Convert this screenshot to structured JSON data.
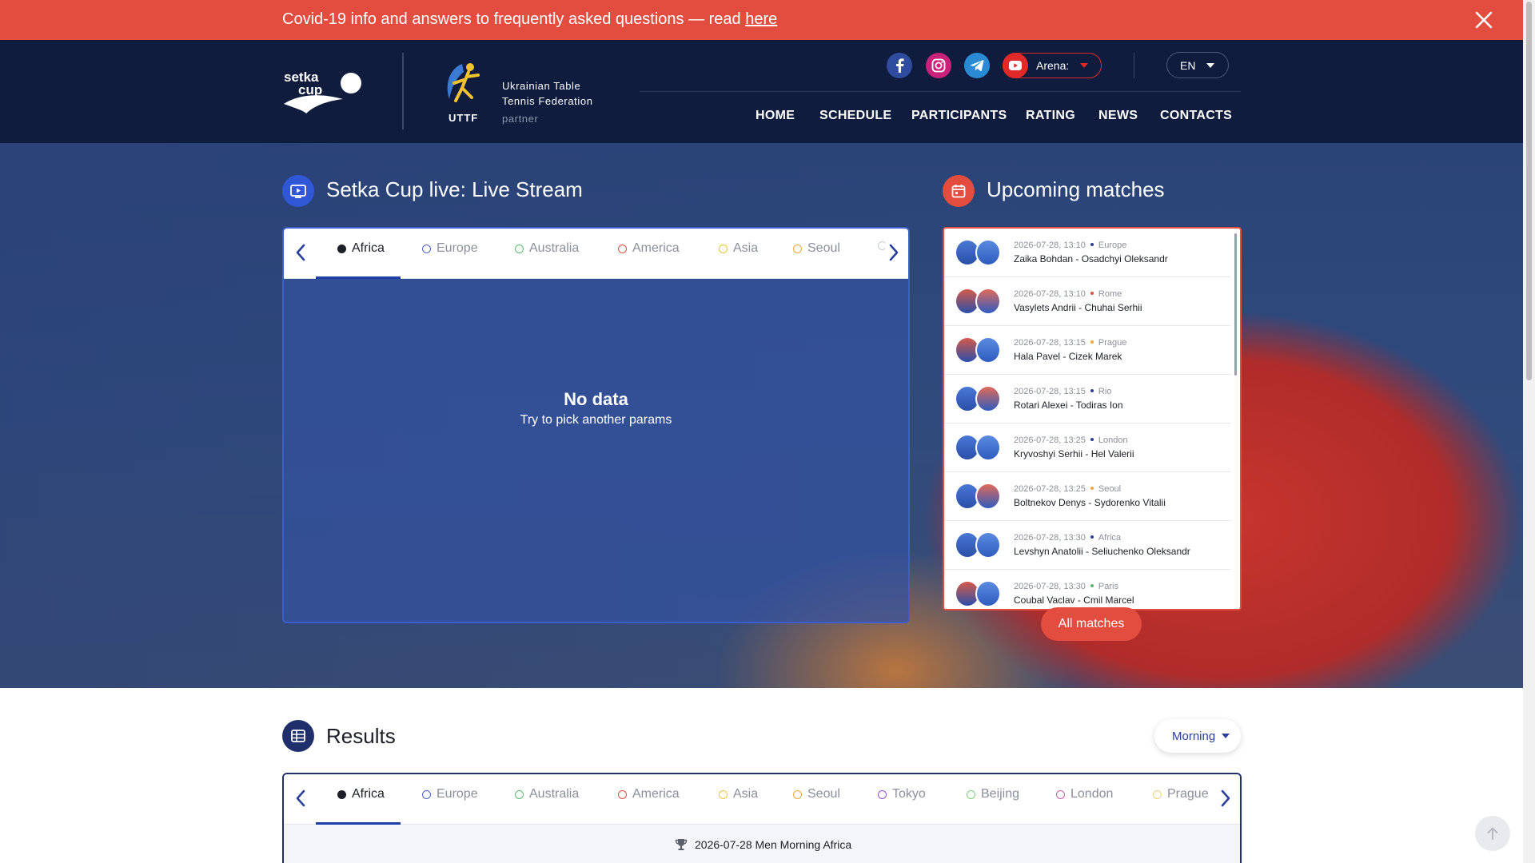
{
  "banner": {
    "text": "Covid-19 info and answers to frequently asked questions — read ",
    "link": "here"
  },
  "header": {
    "uttf_label": "UTTF",
    "uttf_name_line1": "Ukrainian Table",
    "uttf_name_line2": "Tennis Federation",
    "uttf_partner": "partner",
    "arena_label": "Arena:",
    "language": "EN",
    "nav": [
      "HOME",
      "SCHEDULE",
      "PARTICIPANTS",
      "RATING",
      "NEWS",
      "CONTACTS"
    ]
  },
  "live": {
    "title": "Setka Cup live: Live Stream",
    "tabs": [
      {
        "label": "Africa",
        "color": "#1c1f28"
      },
      {
        "label": "Europe",
        "color": "#4f62c9"
      },
      {
        "label": "Australia",
        "color": "#5bb86a"
      },
      {
        "label": "America",
        "color": "#e24d3f"
      },
      {
        "label": "Asia",
        "color": "#f0c53a"
      },
      {
        "label": "Seoul",
        "color": "#f0a53a"
      }
    ],
    "no_data_title": "No data",
    "no_data_sub": "Try to pick another params"
  },
  "upcoming": {
    "title": "Upcoming matches",
    "items": [
      {
        "time": "2026-07-28, 13:10",
        "city": "Europe",
        "dot": "#2a3f9c",
        "players": "Zaika Bohdan - Osadchyi Oleksandr"
      },
      {
        "time": "2026-07-28, 13:10",
        "city": "Rome",
        "dot": "#e24d3f",
        "players": "Vasylets Andrii - Chuhai Serhii"
      },
      {
        "time": "2026-07-28, 13:15",
        "city": "Prague",
        "dot": "#f0a53a",
        "players": "Hala Pavel - Cizek Marek"
      },
      {
        "time": "2026-07-28, 13:15",
        "city": "Rio",
        "dot": "#2a3f9c",
        "players": "Rotari Alexei - Todiras Ion"
      },
      {
        "time": "2026-07-28, 13:25",
        "city": "London",
        "dot": "#2a3f9c",
        "players": "Kryvoshyi Serhii - Hel Valerii"
      },
      {
        "time": "2026-07-28, 13:25",
        "city": "Seoul",
        "dot": "#f0a53a",
        "players": "Boltnekov Denys - Sydorenko Vitalii"
      },
      {
        "time": "2026-07-28, 13:30",
        "city": "Africa",
        "dot": "#2a3f9c",
        "players": "Levshyn Anatolii - Seliuchenko Oleksandr"
      },
      {
        "time": "2026-07-28, 13:30",
        "city": "Paris",
        "dot": "#5bb86a",
        "players": "Coubal Vaclav - Cmil Marcel"
      }
    ],
    "all_button": "All matches"
  },
  "results": {
    "title": "Results",
    "period": "Morning",
    "tabs": [
      {
        "label": "Africa",
        "color": "#1c1f28"
      },
      {
        "label": "Europe",
        "color": "#4f62c9"
      },
      {
        "label": "Australia",
        "color": "#5bb86a"
      },
      {
        "label": "America",
        "color": "#e24d3f"
      },
      {
        "label": "Asia",
        "color": "#f0c53a"
      },
      {
        "label": "Seoul",
        "color": "#f0a53a"
      },
      {
        "label": "Tokyo",
        "color": "#9b4fd0"
      },
      {
        "label": "Beijing",
        "color": "#7ed07a"
      },
      {
        "label": "London",
        "color": "#c95fa8"
      },
      {
        "label": "Prague",
        "color": "#f3d07a"
      }
    ],
    "caption": "2026-07-28 Men Morning Africa"
  },
  "colors": {
    "brand_red": "#e24d3f",
    "navy": "#0f1c3d",
    "accent_blue": "#2a3f9c"
  }
}
